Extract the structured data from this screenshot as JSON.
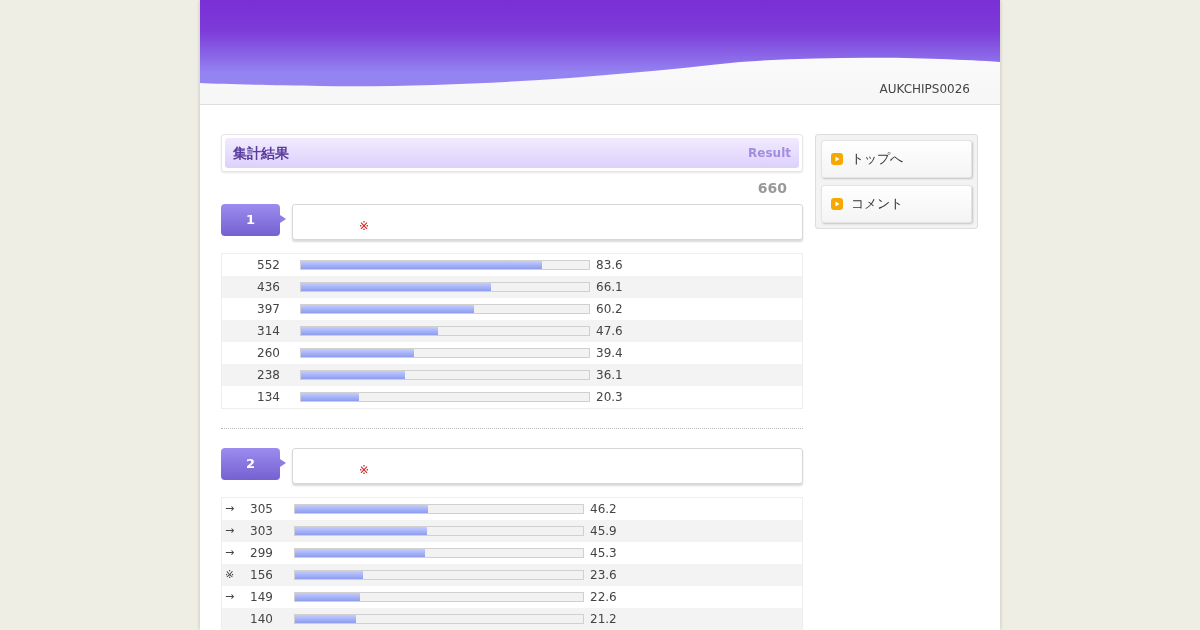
{
  "header": {
    "site_code": "AUKCHIPS0026"
  },
  "section": {
    "title": "集計結果",
    "subtitle": "Result",
    "total": "660"
  },
  "questions": [
    {
      "number": "1",
      "mark": "※",
      "rows": [
        {
          "count": "552",
          "level": 0.836,
          "percent": "83.6"
        },
        {
          "count": "436",
          "level": 0.661,
          "percent": "66.1"
        },
        {
          "count": "397",
          "level": 0.602,
          "percent": "60.2"
        },
        {
          "count": "314",
          "level": 0.476,
          "percent": "47.6"
        },
        {
          "count": "260",
          "level": 0.394,
          "percent": "39.4"
        },
        {
          "count": "238",
          "level": 0.361,
          "percent": "36.1"
        },
        {
          "count": "134",
          "level": 0.203,
          "percent": "20.3"
        }
      ]
    },
    {
      "number": "2",
      "mark": "※",
      "rows": [
        {
          "marker": "→",
          "count": "305",
          "level": 0.462,
          "percent": "46.2"
        },
        {
          "marker": "→",
          "count": "303",
          "level": 0.459,
          "percent": "45.9"
        },
        {
          "marker": "→",
          "count": "299",
          "level": 0.453,
          "percent": "45.3"
        },
        {
          "marker": "※",
          "count": "156",
          "level": 0.236,
          "percent": "23.6"
        },
        {
          "marker": "→",
          "count": "149",
          "level": 0.226,
          "percent": "22.6"
        },
        {
          "count": "140",
          "level": 0.212,
          "percent": "21.2"
        }
      ]
    }
  ],
  "menu": [
    {
      "label": "トップへ"
    },
    {
      "label": "コメント"
    }
  ]
}
